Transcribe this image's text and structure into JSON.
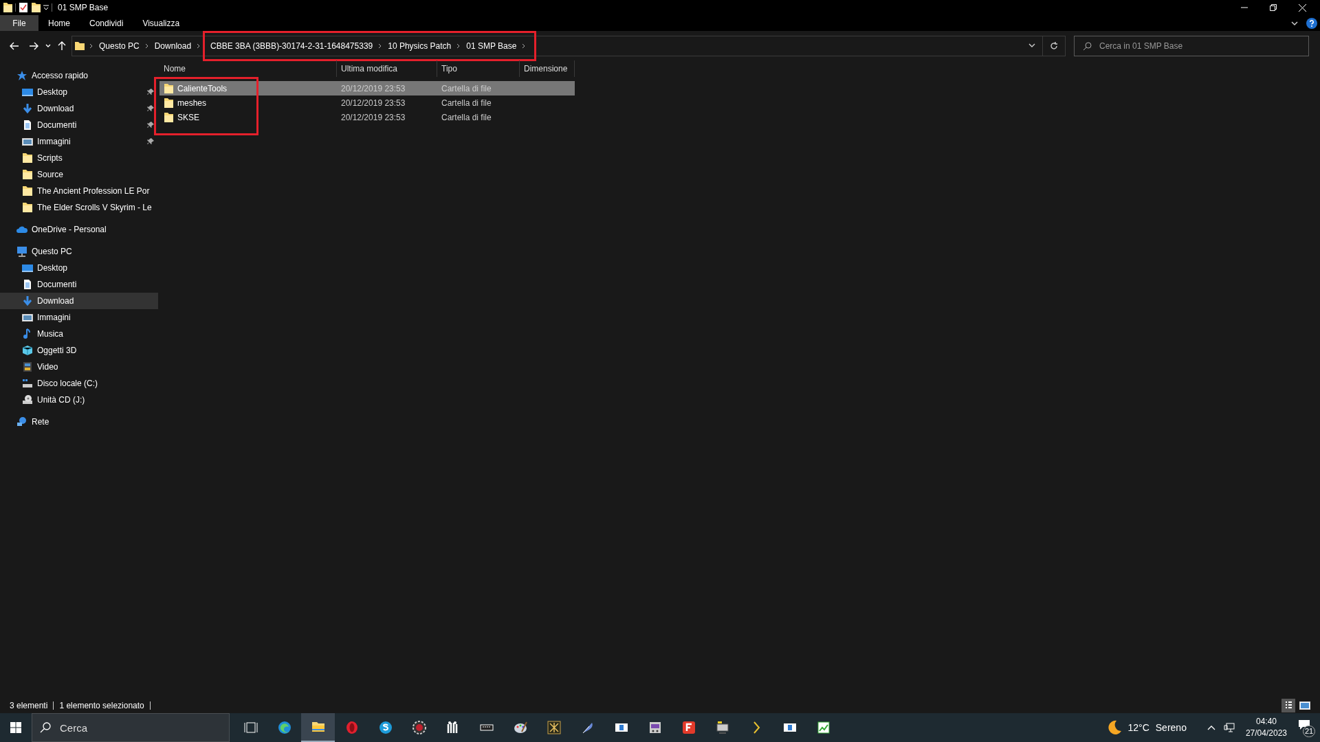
{
  "window": {
    "title": "01 SMP Base"
  },
  "ribbon_tabs": [
    {
      "label": "File",
      "selected": true
    },
    {
      "label": "Home",
      "selected": false
    },
    {
      "label": "Condividi",
      "selected": false
    },
    {
      "label": "Visualizza",
      "selected": false
    }
  ],
  "address_bar": {
    "breadcrumbs": [
      "Questo PC",
      "Download",
      "CBBE 3BA (3BBB)-30174-2-31-1648475339",
      "10 Physics Patch",
      "01 SMP Base"
    ]
  },
  "search": {
    "placeholder": "Cerca in 01 SMP Base"
  },
  "sidebar": {
    "items": [
      {
        "label": "Accesso rapido",
        "kind": "star",
        "selected": false,
        "children": [
          {
            "label": "Desktop",
            "kind": "desktop",
            "pinned": true,
            "selected": false
          },
          {
            "label": "Download",
            "kind": "download",
            "pinned": true,
            "selected": false
          },
          {
            "label": "Documenti",
            "kind": "document",
            "pinned": true,
            "selected": false
          },
          {
            "label": "Immagini",
            "kind": "image",
            "pinned": true,
            "selected": false
          },
          {
            "label": "Scripts",
            "kind": "folder",
            "pinned": false,
            "selected": false
          },
          {
            "label": "Source",
            "kind": "folder",
            "pinned": false,
            "selected": false
          },
          {
            "label": "The Ancient Profession LE Por",
            "kind": "folder",
            "pinned": false,
            "selected": false
          },
          {
            "label": "The Elder Scrolls V Skyrim - Le",
            "kind": "folder",
            "pinned": false,
            "selected": false
          }
        ]
      },
      {
        "label": "OneDrive - Personal",
        "kind": "cloud",
        "selected": false
      },
      {
        "label": "Questo PC",
        "kind": "pc",
        "selected": false,
        "children": [
          {
            "label": "Desktop",
            "kind": "desktop",
            "pinned": false,
            "selected": false
          },
          {
            "label": "Documenti",
            "kind": "document",
            "pinned": false,
            "selected": false
          },
          {
            "label": "Download",
            "kind": "download",
            "pinned": false,
            "selected": true
          },
          {
            "label": "Immagini",
            "kind": "image",
            "pinned": false,
            "selected": false
          },
          {
            "label": "Musica",
            "kind": "music",
            "pinned": false,
            "selected": false
          },
          {
            "label": "Oggetti 3D",
            "kind": "cube",
            "pinned": false,
            "selected": false
          },
          {
            "label": "Video",
            "kind": "video",
            "pinned": false,
            "selected": false
          },
          {
            "label": "Disco locale (C:)",
            "kind": "drive",
            "pinned": false,
            "selected": false
          },
          {
            "label": "Unità CD (J:)",
            "kind": "cd",
            "pinned": false,
            "selected": false
          }
        ]
      },
      {
        "label": "Rete",
        "kind": "network",
        "selected": false
      }
    ]
  },
  "table": {
    "columns": [
      "Nome",
      "Ultima modifica",
      "Tipo",
      "Dimensione"
    ],
    "rows": [
      {
        "name": "CalienteTools",
        "modified": "20/12/2019 23:53",
        "type": "Cartella di file",
        "selected": true
      },
      {
        "name": "meshes",
        "modified": "20/12/2019 23:53",
        "type": "Cartella di file",
        "selected": false
      },
      {
        "name": "SKSE",
        "modified": "20/12/2019 23:53",
        "type": "Cartella di file",
        "selected": false
      }
    ]
  },
  "status_bar": {
    "items": [
      "3 elementi",
      "1 elemento selezionato"
    ]
  },
  "taskbar": {
    "search_placeholder": "Cerca",
    "apps": [
      {
        "kind": "taskview",
        "selected": false
      },
      {
        "kind": "edge",
        "selected": false
      },
      {
        "kind": "explorer",
        "selected": true
      },
      {
        "kind": "opera",
        "selected": false
      },
      {
        "kind": "skype",
        "selected": false
      },
      {
        "kind": "gear",
        "selected": false
      },
      {
        "kind": "grid",
        "selected": false
      },
      {
        "kind": "chip",
        "selected": false
      },
      {
        "kind": "palette",
        "selected": false
      },
      {
        "kind": "emblem",
        "selected": false
      },
      {
        "kind": "feather",
        "selected": false
      },
      {
        "kind": "window",
        "selected": false
      },
      {
        "kind": "tool",
        "selected": false
      },
      {
        "kind": "letter",
        "selected": false
      },
      {
        "kind": "monitor",
        "selected": false
      },
      {
        "kind": "chevron",
        "selected": false
      },
      {
        "kind": "window",
        "selected": false
      },
      {
        "kind": "chart",
        "selected": false
      }
    ],
    "weather": {
      "temperature": "12°C",
      "condition": "Sereno"
    },
    "time": "04:40",
    "date": "27/04/2023",
    "notifications": "21"
  }
}
